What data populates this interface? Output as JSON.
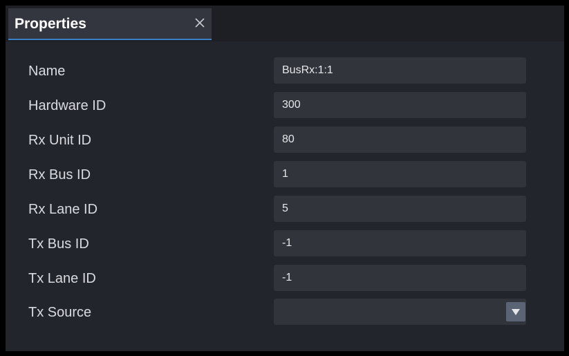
{
  "panel": {
    "tab_title": "Properties",
    "close_icon": "close-icon"
  },
  "properties": [
    {
      "label": "Name",
      "value": "BusRx:1:1"
    },
    {
      "label": "Hardware ID",
      "value": "300"
    },
    {
      "label": "Rx Unit ID",
      "value": "80"
    },
    {
      "label": "Rx Bus ID",
      "value": "1"
    },
    {
      "label": "Rx Lane ID",
      "value": "5"
    },
    {
      "label": "Tx Bus ID",
      "value": "-1"
    },
    {
      "label": "Tx Lane ID",
      "value": "-1"
    },
    {
      "label": "Tx Source",
      "value": "",
      "type": "select",
      "icon": "chevron-down-icon"
    }
  ],
  "colors": {
    "panel_bg": "#23252c",
    "field_bg": "#31343b",
    "accent": "#3d80c8",
    "label_text": "#d9dbe0"
  }
}
